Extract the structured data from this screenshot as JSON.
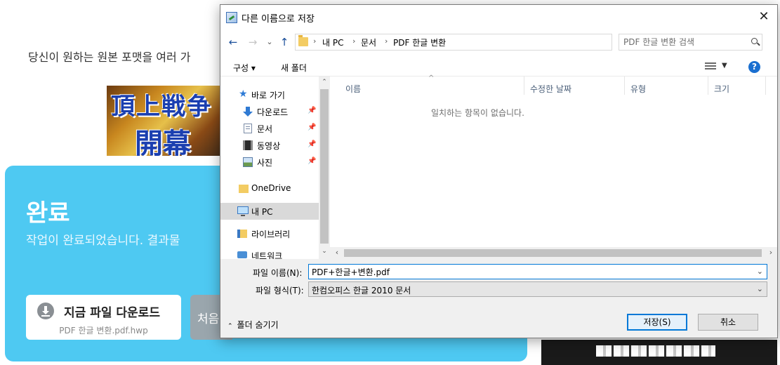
{
  "background": {
    "intro_text": "당신이 원하는 원본 포맷을 여러 가",
    "banner": {
      "line1": "頂上戦争",
      "line2": "開幕"
    },
    "card": {
      "title": "완료",
      "description": "작업이 완료되었습니다. 결과물",
      "download_button": {
        "label": "지금 파일 다운로드",
        "filename": "PDF 한글 변환.pdf.hwp"
      },
      "restart_button_label": "처음"
    }
  },
  "dialog": {
    "title": "다른 이름으로 저장",
    "close_icon": "close-icon",
    "nav": {
      "back_icon": "←",
      "forward_icon": "→",
      "recent_icon": "⌄",
      "up_icon": "↑",
      "breadcrumbs": [
        "내 PC",
        "문서",
        "PDF 한글 변환"
      ],
      "refresh_icon": "↻"
    },
    "search": {
      "placeholder": "PDF 한글 변환 검색"
    },
    "toolbar": {
      "organize": "구성 ▾",
      "new_folder": "새 폴더",
      "help": "?"
    },
    "tree": {
      "items": [
        {
          "label": "바로 가기",
          "icon": "star-icon"
        },
        {
          "label": "다운로드",
          "icon": "download-icon",
          "pinned": true
        },
        {
          "label": "문서",
          "icon": "document-icon",
          "pinned": true
        },
        {
          "label": "동영상",
          "icon": "video-icon",
          "pinned": true
        },
        {
          "label": "사진",
          "icon": "photo-icon",
          "pinned": true
        },
        {
          "label": "OneDrive",
          "icon": "folder-icon"
        },
        {
          "label": "내 PC",
          "icon": "pc-icon",
          "selected": true
        },
        {
          "label": "라이브러리",
          "icon": "library-icon"
        },
        {
          "label": "네트워크",
          "icon": "network-icon"
        }
      ]
    },
    "columns": [
      "이름",
      "수정한 날짜",
      "유형",
      "크기"
    ],
    "empty_message": "일치하는 항목이 없습니다.",
    "filename": {
      "label": "파일 이름(N):",
      "value": "PDF+한글+변환.pdf"
    },
    "filetype": {
      "label": "파일 형식(T):",
      "value": "한컴오피스 한글 2010 문서"
    },
    "hide_folders": "폴더 숨기기",
    "save_button": "저장(S)",
    "cancel_button": "취소"
  },
  "colors": {
    "card": "#4ec9f2",
    "accent": "#0078d7",
    "help": "#1a6fd0"
  }
}
